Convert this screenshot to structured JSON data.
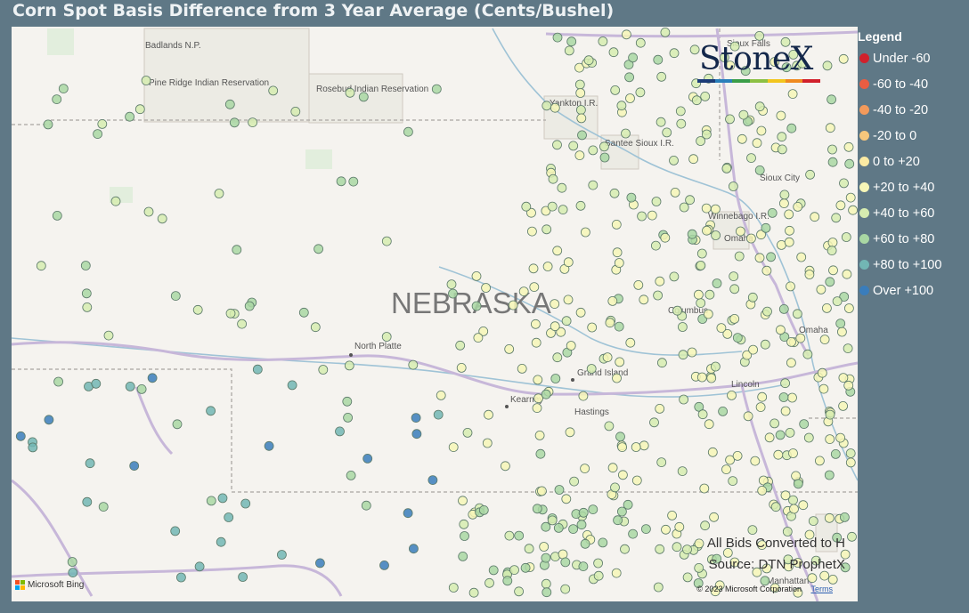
{
  "title": "Corn Spot Basis Difference from 3 Year Average (Cents/Bushel)",
  "legend": {
    "title": "Legend",
    "items": [
      {
        "label": "Under -60",
        "color": "#d1202b"
      },
      {
        "label": "-60 to -40",
        "color": "#e85d42"
      },
      {
        "label": "-40 to -20",
        "color": "#f39a5b"
      },
      {
        "label": "-20 to 0",
        "color": "#f7c77c"
      },
      {
        "label": "0 to +20",
        "color": "#fbeaa3"
      },
      {
        "label": "+20 to +40",
        "color": "#f6f6b7"
      },
      {
        "label": "+40 to +60",
        "color": "#d6ecb0"
      },
      {
        "label": "+60 to +80",
        "color": "#a9d7a3"
      },
      {
        "label": "+80 to +100",
        "color": "#72b6b4"
      },
      {
        "label": "Over +100",
        "color": "#3a7dbb"
      }
    ]
  },
  "logo": {
    "text": "StoneX",
    "bar_colors": [
      "#1c3c78",
      "#2a7fba",
      "#3a9d48",
      "#8cc043",
      "#f2c51d",
      "#ef8a1f",
      "#d1202b"
    ]
  },
  "map": {
    "state_label": "NEBRASKA",
    "places": [
      "Badlands N.P.",
      "Pine Ridge Indian Reservation",
      "Rosebud Indian Reservation",
      "Yankton I.R.",
      "Santee Sioux I.R.",
      "Sioux Falls",
      "Sioux City",
      "Winnebago I.R.",
      "Omaha",
      "Columbus",
      "Omaha",
      "North Platte",
      "Grand Island",
      "Kearney",
      "Hastings",
      "Lincoln",
      "Manhattan"
    ]
  },
  "notes": {
    "line1": "All Bids Converted to H",
    "line2": "Source: DTN ProphetX"
  },
  "attribution": {
    "bing": "Microsoft Bing",
    "copyright": "© 2023 Microsoft Corporation",
    "terms": "Terms"
  }
}
